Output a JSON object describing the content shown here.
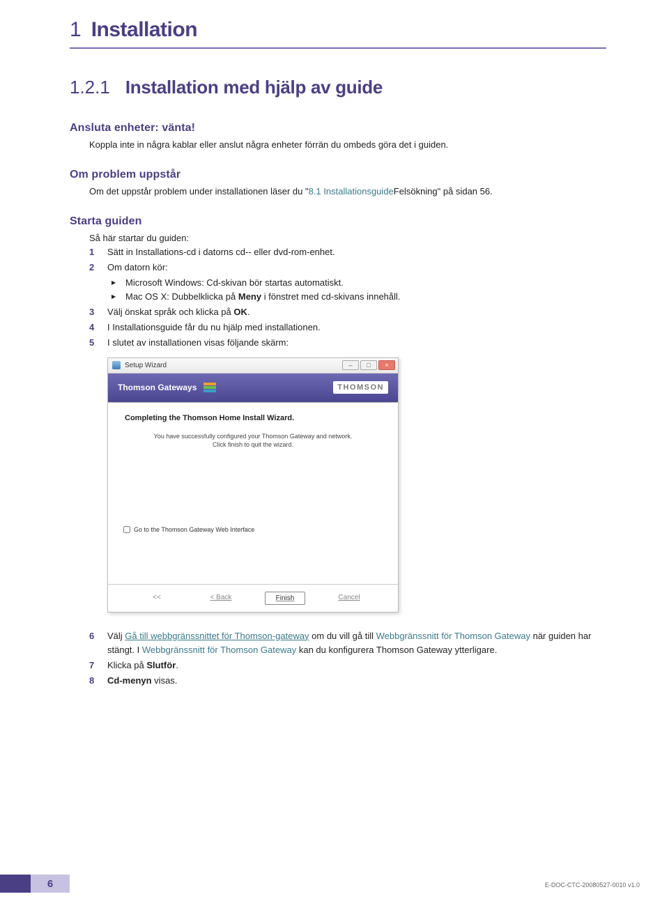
{
  "chapter": {
    "num": "1",
    "title": "Installation"
  },
  "section": {
    "num": "1.2.1",
    "title": "Installation med hjälp av guide"
  },
  "b1": {
    "title": "Ansluta enheter: vänta!",
    "text": "Koppla inte in några kablar eller anslut några enheter förrän du ombeds göra det i guiden."
  },
  "b2": {
    "title": "Om problem uppstår",
    "text_a": "Om det uppstår problem under installationen läser du ",
    "quote_a": "\"",
    "link": "8.1 Installationsguide",
    "text_b": "Felsökning\" på sidan 56",
    "text_c": "."
  },
  "b3": {
    "title": "Starta guiden",
    "intro": "Så här startar du guiden:",
    "items": [
      {
        "n": "1",
        "text": "Sätt in Installations-cd i datorns cd-- eller dvd-rom-enhet."
      },
      {
        "n": "2",
        "text": "Om datorn kör:",
        "sub": [
          "Microsoft Windows: Cd-skivan bör startas automatiskt.",
          {
            "pre": "Mac OS X: Dubbelklicka på ",
            "bold": "Meny",
            "post": " i fönstret med cd-skivans innehåll."
          }
        ]
      },
      {
        "n": "3",
        "pre": "Välj önskat språk och klicka på ",
        "bold": "OK",
        "post": "."
      },
      {
        "n": "4",
        "text": "I Installationsguide får du nu hjälp med installationen."
      },
      {
        "n": "5",
        "text": "I slutet av installationen visas följande skärm:"
      }
    ],
    "items2": [
      {
        "n": "6",
        "pre": "Välj ",
        "link": "Gå till webbgränssnittet för Thomson-gateway",
        "mid": " om du vill gå till ",
        "link2": "Webbgränssnitt för Thomson Gateway",
        "mid2": " när guiden har stängt. I ",
        "link3": "Webbgränssnitt för Thomson Gateway",
        "post": " kan du konfigurera Thomson Gateway ytterligare."
      },
      {
        "n": "7",
        "pre": "Klicka på ",
        "bold": "Slutför",
        "post": "."
      },
      {
        "n": "8",
        "bold": "Cd-menyn",
        "post": " visas."
      }
    ]
  },
  "wizard": {
    "titlebar": "Setup Wizard",
    "bannerText": "Thomson Gateways",
    "brand": "THOMSON",
    "heading": "Completing the Thomson Home Install Wizard.",
    "msg1": "You have successfully configured your Thomson Gateway and network.",
    "msg2": "Click finish to quit the wizard.",
    "checkbox": "Go to the Thomson Gateway Web Interface",
    "btnPrev": "<<",
    "btnBack": "< Back",
    "btnFinish": "Finish",
    "btnCancel": "Cancel"
  },
  "footer": {
    "pagenum": "6",
    "docid": "E-DOC-CTC-20080527-0010 v1.0"
  }
}
